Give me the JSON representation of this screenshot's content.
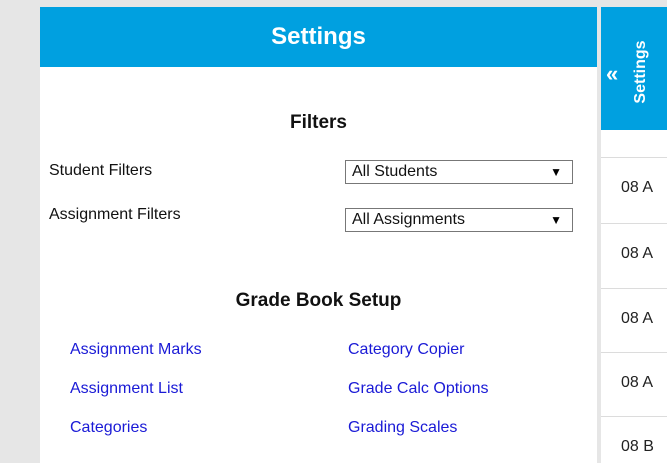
{
  "panel": {
    "title": "Settings",
    "filters": {
      "heading": "Filters",
      "student_label": "Student Filters",
      "student_value": "All Students",
      "assignment_label": "Assignment Filters",
      "assignment_value": "All Assignments"
    },
    "gradebook": {
      "heading": "Grade Book Setup",
      "left_links": [
        "Assignment Marks",
        "Assignment List",
        "Categories"
      ],
      "right_links": [
        "Category Copier",
        "Grade Calc Options",
        "Grading Scales"
      ]
    }
  },
  "side": {
    "tab_label": "Settings",
    "rows": [
      "08 A",
      "08 A",
      "08 A",
      "08 A",
      "08 B"
    ]
  },
  "colors": {
    "accent": "#00a0e0",
    "link": "#1a1ad6",
    "background": "#e6e6e6"
  },
  "icons": {
    "collapse": "double-chevron-left-icon",
    "select_arrow": "triangle-down-icon"
  }
}
